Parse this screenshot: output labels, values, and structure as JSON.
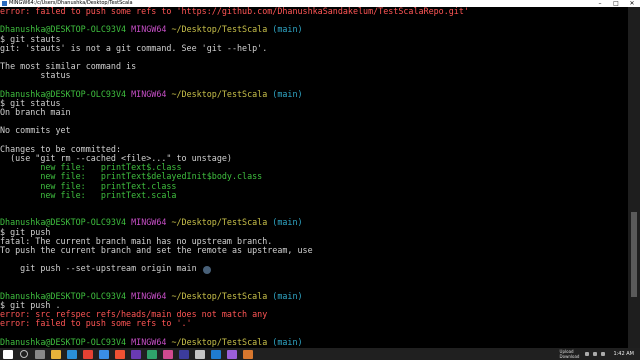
{
  "window": {
    "title": "MINGW64:/c/Users/Dhanushka/Desktop/TestScala",
    "controls": [
      "–",
      "□",
      "✕"
    ]
  },
  "terminal": {
    "lines": [
      [
        {
          "t": "error: failed to push some refs to 'https://github.com/DhanushkaSandakelum/TestScalaRepo.git'",
          "c": "red"
        }
      ],
      [
        {
          "t": "",
          "c": ""
        }
      ],
      [
        {
          "t": "Dhanushka@DESKTOP-OLC93V4 ",
          "c": "green"
        },
        {
          "t": "MINGW64 ",
          "c": "mag"
        },
        {
          "t": "~/Desktop/TestScala ",
          "c": "yel"
        },
        {
          "t": "(main)",
          "c": "cyan"
        }
      ],
      [
        {
          "t": "$ git stauts",
          "c": ""
        }
      ],
      [
        {
          "t": "git: 'stauts' is not a git command. See 'git --help'.",
          "c": ""
        }
      ],
      [
        {
          "t": "",
          "c": ""
        }
      ],
      [
        {
          "t": "The most similar command is",
          "c": ""
        }
      ],
      [
        {
          "t": "        status",
          "c": ""
        }
      ],
      [
        {
          "t": "",
          "c": ""
        }
      ],
      [
        {
          "t": "Dhanushka@DESKTOP-OLC93V4 ",
          "c": "green"
        },
        {
          "t": "MINGW64 ",
          "c": "mag"
        },
        {
          "t": "~/Desktop/TestScala ",
          "c": "yel"
        },
        {
          "t": "(main)",
          "c": "cyan"
        }
      ],
      [
        {
          "t": "$ git status",
          "c": ""
        }
      ],
      [
        {
          "t": "On branch main",
          "c": ""
        }
      ],
      [
        {
          "t": "",
          "c": ""
        }
      ],
      [
        {
          "t": "No commits yet",
          "c": ""
        }
      ],
      [
        {
          "t": "",
          "c": ""
        }
      ],
      [
        {
          "t": "Changes to be committed:",
          "c": ""
        }
      ],
      [
        {
          "t": "  (use \"git rm --cached <file>...\" to unstage)",
          "c": ""
        }
      ],
      [
        {
          "t": "        new file:   printText$.class",
          "c": "green"
        }
      ],
      [
        {
          "t": "        new file:   printText$delayedInit$body.class",
          "c": "green"
        }
      ],
      [
        {
          "t": "        new file:   printText.class",
          "c": "green"
        }
      ],
      [
        {
          "t": "        new file:   printText.scala",
          "c": "green"
        }
      ],
      [
        {
          "t": "",
          "c": ""
        }
      ],
      [
        {
          "t": "",
          "c": ""
        }
      ],
      [
        {
          "t": "Dhanushka@DESKTOP-OLC93V4 ",
          "c": "green"
        },
        {
          "t": "MINGW64 ",
          "c": "mag"
        },
        {
          "t": "~/Desktop/TestScala ",
          "c": "yel"
        },
        {
          "t": "(main)",
          "c": "cyan"
        }
      ],
      [
        {
          "t": "$ git push",
          "c": ""
        }
      ],
      [
        {
          "t": "fatal: The current branch main has no upstream branch.",
          "c": ""
        }
      ],
      [
        {
          "t": "To push the current branch and set the remote as upstream, use",
          "c": ""
        }
      ],
      [
        {
          "t": "",
          "c": ""
        }
      ],
      [
        {
          "t": "    git push --set-upstream origin main",
          "c": ""
        }
      ],
      [
        {
          "t": "",
          "c": ""
        }
      ],
      [
        {
          "t": "",
          "c": ""
        }
      ],
      [
        {
          "t": "Dhanushka@DESKTOP-OLC93V4 ",
          "c": "green"
        },
        {
          "t": "MINGW64 ",
          "c": "mag"
        },
        {
          "t": "~/Desktop/TestScala ",
          "c": "yel"
        },
        {
          "t": "(main)",
          "c": "cyan"
        }
      ],
      [
        {
          "t": "$ git push .",
          "c": ""
        }
      ],
      [
        {
          "t": "error: src refspec refs/heads/main does not match any",
          "c": "red"
        }
      ],
      [
        {
          "t": "error: failed to push some refs to '.'",
          "c": "red"
        }
      ],
      [
        {
          "t": "",
          "c": ""
        }
      ],
      [
        {
          "t": "Dhanushka@DESKTOP-OLC93V4 ",
          "c": "green"
        },
        {
          "t": "MINGW64 ",
          "c": "mag"
        },
        {
          "t": "~/Desktop/TestScala ",
          "c": "yel"
        },
        {
          "t": "(main)",
          "c": "cyan"
        }
      ]
    ]
  },
  "taskbar": {
    "icons": [
      {
        "name": "windows-start-icon",
        "color": "#ffffff"
      },
      {
        "name": "search-icon",
        "color": "#bbbbbb"
      },
      {
        "name": "task-view-icon",
        "color": "#888888"
      },
      {
        "name": "explorer-icon",
        "color": "#e8b33a"
      },
      {
        "name": "edge-icon",
        "color": "#2a8fd8"
      },
      {
        "name": "chrome-icon",
        "color": "#e34133"
      },
      {
        "name": "vscode-icon",
        "color": "#3a8ee6"
      },
      {
        "name": "git-bash-icon",
        "color": "#f05133"
      },
      {
        "name": "app-icon-1",
        "color": "#6a3ab3"
      },
      {
        "name": "app-icon-2",
        "color": "#2fa36b"
      },
      {
        "name": "app-icon-3",
        "color": "#d14a8f"
      },
      {
        "name": "app-icon-4",
        "color": "#3c3c9c"
      },
      {
        "name": "app-icon-5",
        "color": "#c5c5c5"
      },
      {
        "name": "app-icon-6",
        "color": "#1f7bd0"
      },
      {
        "name": "app-icon-7",
        "color": "#9b5fd9"
      },
      {
        "name": "app-icon-8",
        "color": "#d8772e"
      }
    ],
    "network": {
      "upload": "Upload",
      "download": "Download"
    },
    "time": "1:42 AM"
  }
}
